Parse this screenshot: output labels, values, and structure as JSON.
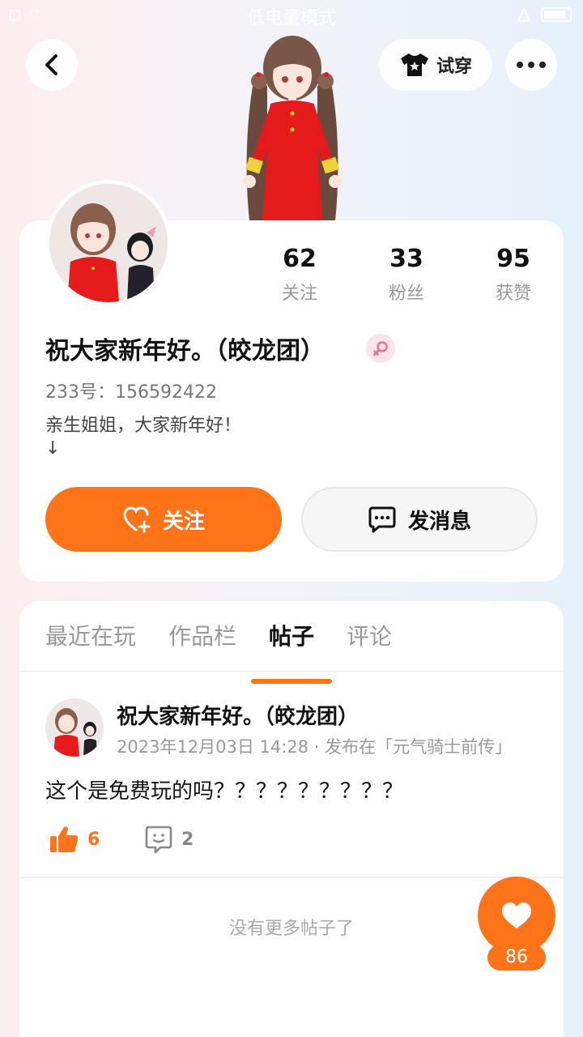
{
  "status_bar": {
    "left": "⊡ ⌔",
    "center": "低电量模式"
  },
  "header": {
    "tryon_label": "试穿"
  },
  "profile": {
    "stats": [
      {
        "value": "62",
        "label": "关注"
      },
      {
        "value": "33",
        "label": "粉丝"
      },
      {
        "value": "95",
        "label": "获赞"
      }
    ],
    "nickname": "祝大家新年好。（皎龙团）",
    "gender": "female",
    "user_id": "233号：156592422",
    "bio_line1": "亲生姐姐，大家新年好！",
    "bio_line2": "↓",
    "follow_label": "关注",
    "message_label": "发消息"
  },
  "tabs": [
    {
      "label": "最近在玩",
      "active": false
    },
    {
      "label": "作品栏",
      "active": false
    },
    {
      "label": "帖子",
      "active": true
    },
    {
      "label": "评论",
      "active": false
    }
  ],
  "post": {
    "author": "祝大家新年好。（皎龙团）",
    "meta": "2023年12月03日 14:28 · 发布在「元气骑士前传」",
    "body": "这个是免费玩的吗？？？？？？？？？",
    "likes": "6",
    "comments": "2"
  },
  "no_more_text": "没有更多帖子了",
  "favorite_count": "86",
  "colors": {
    "accent": "#ff7418",
    "female_badge": "#fde3ea"
  }
}
